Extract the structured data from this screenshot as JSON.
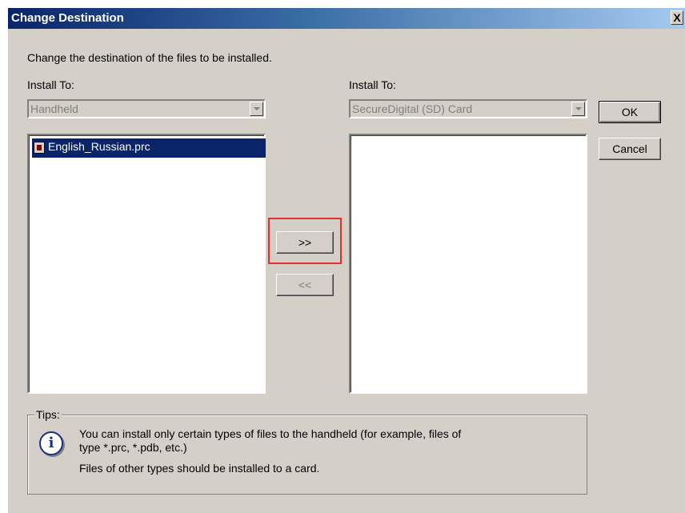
{
  "dialog": {
    "title": "Change Destination",
    "close_glyph": "X",
    "instruction": "Change the destination of the files to be installed."
  },
  "left_panel": {
    "label": "Install To:",
    "combo_value": "Handheld",
    "files": [
      {
        "name": "English_Russian.prc",
        "icon": "prc-file-icon",
        "selected": true
      }
    ]
  },
  "right_panel": {
    "label": "Install To:",
    "combo_value": "SecureDigital (SD) Card",
    "files": []
  },
  "buttons": {
    "move_right": ">>",
    "move_left": "<<",
    "ok": "OK",
    "cancel": "Cancel"
  },
  "tips": {
    "title": "Tips:",
    "icon": "info-icon",
    "line1": "You can install only certain types of files to the handheld (for example, files of",
    "line2": "type *.prc, *.pdb, etc.)",
    "line3": "Files of other types should be installed to a card."
  },
  "colors": {
    "titlebar_start": "#0a246a",
    "titlebar_end": "#a6caf0",
    "dialog_bg": "#d4d0c8",
    "selection": "#0a246a",
    "highlight_box": "#e03030"
  }
}
